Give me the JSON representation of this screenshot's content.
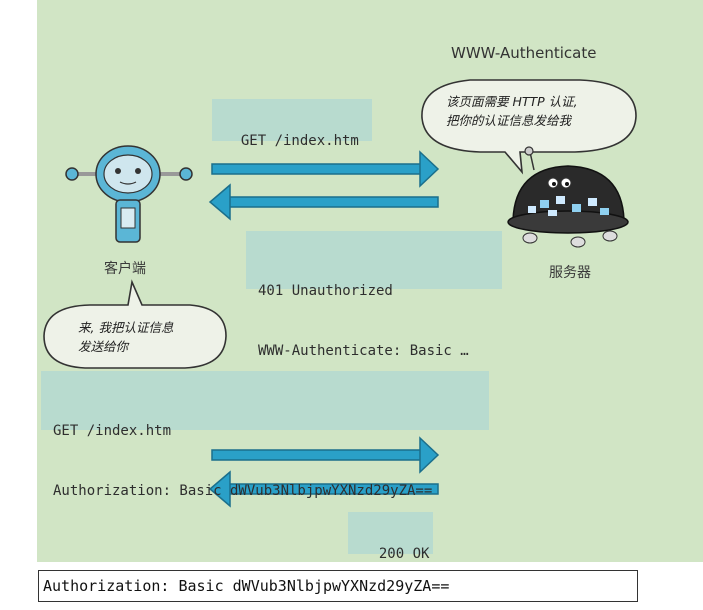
{
  "header_label": "WWW-Authenticate",
  "request1": "GET /index.htm",
  "response1": [
    "401 Unauthorized",
    "WWW-Authenticate: Basic …"
  ],
  "server_bubble": [
    "该页面需要 HTTP 认证,",
    "把你的认证信息发给我"
  ],
  "client_label": "客户端",
  "server_label": "服务器",
  "client_bubble": [
    "来, 我把认证信息",
    "发送给你"
  ],
  "request2": [
    "GET /index.htm",
    "Authorization: Basic dWVub3NlbjpwYXNzd29yZA=="
  ],
  "response2": "200 OK",
  "footer": "Authorization: Basic dWVub3NlbjpwYXNzd29yZA==",
  "colors": {
    "panel_bg": "#d1e5c5",
    "box_bg": "#b8dbcf",
    "arrow": "#2aa0c8",
    "arrow_dark": "#1b6f8c",
    "client_robot": "#5bb6d6",
    "server_robot": "#2a2a2a"
  }
}
